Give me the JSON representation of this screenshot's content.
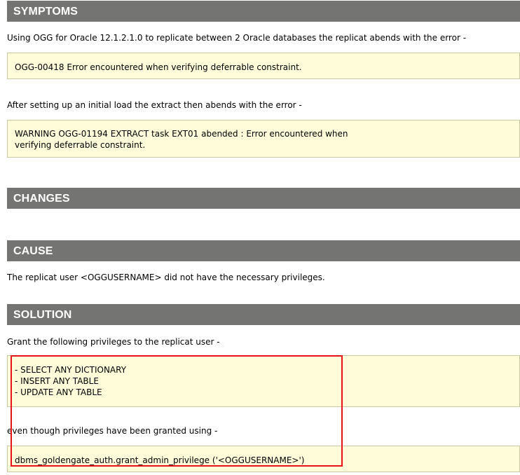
{
  "symptoms": {
    "heading": "SYMPTOMS",
    "intro": "Using OGG for Oracle 12.1.2.1.0 to replicate between 2 Oracle databases the replicat abends with the error -",
    "error1": "OGG-00418  Error encountered when verifying deferrable constraint.",
    "followup": "After setting up an initial load the extract then abends with the error -",
    "error2_lines": [
      "WARNING OGG-01194  EXTRACT task EXT01 abended : Error encountered when",
      "verifying deferrable constraint."
    ]
  },
  "changes": {
    "heading": "CHANGES"
  },
  "cause": {
    "heading": "CAUSE",
    "text": "The replicat user <OGGUSERNAME> did not have the necessary privileges."
  },
  "solution": {
    "heading": "SOLUTION",
    "intro": "Grant the following privileges to the replicat user -",
    "privileges": [
      "- SELECT ANY DICTIONARY",
      "- INSERT ANY TABLE",
      "- UPDATE ANY TABLE"
    ],
    "note": "even though privileges have been granted using -",
    "command": "dbms_goldengate_auth.grant_admin_privilege ('<OGGUSERNAME>')"
  },
  "colors": {
    "header_bg": "#747473",
    "code_bg": "#fffdd9",
    "highlight": "#e8121b"
  }
}
